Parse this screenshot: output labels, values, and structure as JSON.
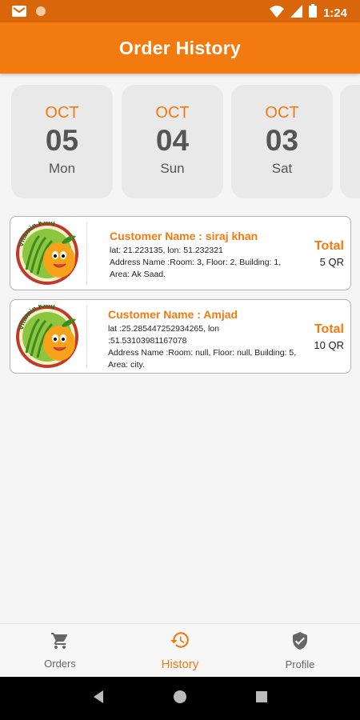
{
  "status_bar": {
    "time": "1:24"
  },
  "app_bar": {
    "title": "Order History"
  },
  "dates": [
    {
      "month": "OCT",
      "day": "05",
      "weekday": "Mon"
    },
    {
      "month": "OCT",
      "day": "04",
      "weekday": "Sun"
    },
    {
      "month": "OCT",
      "day": "03",
      "weekday": "Sat"
    }
  ],
  "orders": [
    {
      "customer": "Customer Name : siraj khan",
      "coords": "lat: 21.223135,  lon: 51.232321",
      "address": "Address Name :Room: 3, Floor: 2, Building: 1, Area: Ak Saad.",
      "total_label": "Total",
      "total_value": "5 QR"
    },
    {
      "customer": "Customer Name : Amjad",
      "coords": "lat :25.285447252934265, lon :51.53103981167078",
      "address": "Address Name :Room: null, Floor: null, Building: 5, Area: city.",
      "total_label": "Total",
      "total_value": "10 QR"
    }
  ],
  "logo": {
    "text": "Vitamin King"
  },
  "bottom_nav": [
    {
      "label": "Orders",
      "icon": "cart-icon",
      "active": false
    },
    {
      "label": "History",
      "icon": "history-icon",
      "active": true
    },
    {
      "label": "Profile",
      "icon": "shield-check-icon",
      "active": false
    }
  ],
  "colors": {
    "accent": "#f27a0e",
    "status_bar": "#d9660a",
    "card_bg": "#e9e9e9"
  }
}
